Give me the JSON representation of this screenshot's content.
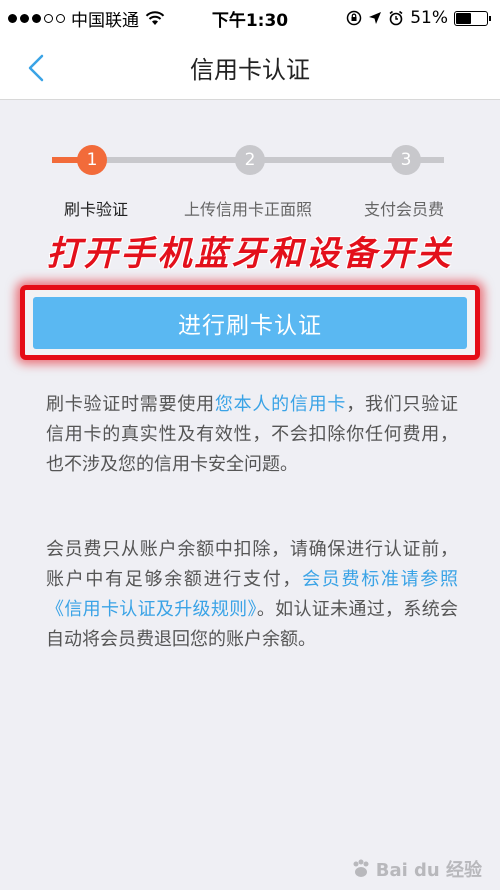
{
  "status_bar": {
    "carrier": "中国联通",
    "time": "下午1:30",
    "battery": "51%",
    "battery_level": 0.51
  },
  "nav": {
    "title": "信用卡认证"
  },
  "steps": [
    {
      "number": "1",
      "label": "刷卡验证",
      "active": true
    },
    {
      "number": "2",
      "label": "上传信用卡正面照",
      "active": false
    },
    {
      "number": "3",
      "label": "支付会员费",
      "active": false
    }
  ],
  "banner": "打开手机蓝牙和设备开关",
  "cta": {
    "label": "进行刷卡认证"
  },
  "para1": {
    "prefix": "刷卡验证时需要使用",
    "link": "您本人的信用卡",
    "suffix": "，我们只验证信用卡的真实性及有效性，不会扣除你任何费用，也不涉及您的信用卡安全问题。"
  },
  "para2": {
    "prefix": "会员费只从账户余额中扣除，请确保进行认证前，账户中有足够余额进行支付，",
    "link": "会员费标准请参照《信用卡认证及升级规则》",
    "suffix": "。如认证未通过，系统会自动将会员费退回您的账户余额。"
  },
  "watermark": "Bai du 经验",
  "colors": {
    "accent": "#f26b3a",
    "button": "#5ab8f2",
    "link": "#3aa3e6",
    "banner": "#e3101b"
  }
}
